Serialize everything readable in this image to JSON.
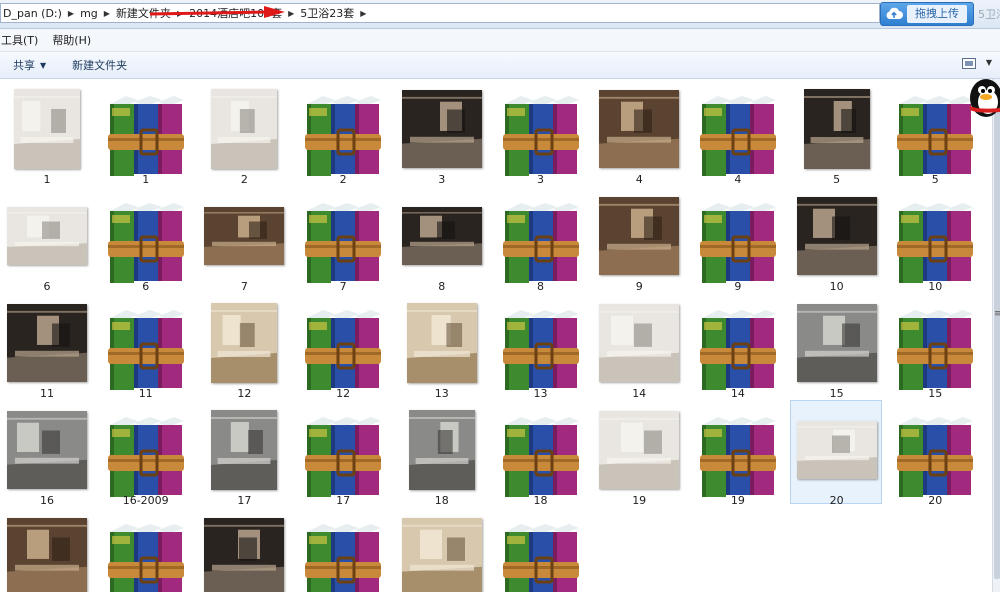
{
  "address": {
    "crumbs": [
      "D_pan (D:)",
      "mg",
      "新建文件夹",
      "2014酒店吧100套",
      "5卫浴23套"
    ],
    "faded_tab": "5卫浴"
  },
  "upload": {
    "label": "拖拽上传",
    "icon": "cloud-upload-icon"
  },
  "menu": [
    "工具(T)",
    "帮助(H)"
  ],
  "commands": {
    "share": "共享",
    "new_folder": "新建文件夹"
  },
  "colors": {
    "selection": "#e8f2fd",
    "upload_button": "#3d8edb",
    "rar_green": "#3d8b2e",
    "rar_blue": "#2a4fa8",
    "rar_magenta": "#a12a7e",
    "rar_belt": "#c8893a"
  },
  "files": [
    {
      "name": "1",
      "kind": "image",
      "style": "sq",
      "tone": "light"
    },
    {
      "name": "1",
      "kind": "rar"
    },
    {
      "name": "2",
      "kind": "image",
      "style": "sq",
      "tone": "light"
    },
    {
      "name": "2",
      "kind": "rar"
    },
    {
      "name": "3",
      "kind": "image",
      "style": "dark",
      "tone": "dark"
    },
    {
      "name": "3",
      "kind": "rar"
    },
    {
      "name": "4",
      "kind": "image",
      "style": "dark",
      "tone": "brown"
    },
    {
      "name": "4",
      "kind": "rar"
    },
    {
      "name": "5",
      "kind": "image",
      "style": "sq",
      "tone": "dark"
    },
    {
      "name": "5",
      "kind": "rar"
    },
    {
      "name": "6",
      "kind": "image",
      "style": "wd",
      "tone": "light"
    },
    {
      "name": "6",
      "kind": "rar"
    },
    {
      "name": "7",
      "kind": "image",
      "style": "wd",
      "tone": "brown"
    },
    {
      "name": "7",
      "kind": "rar"
    },
    {
      "name": "8",
      "kind": "image",
      "style": "wd",
      "tone": "dark"
    },
    {
      "name": "8",
      "kind": "rar"
    },
    {
      "name": "9",
      "kind": "image",
      "style": "dark",
      "tone": "brown"
    },
    {
      "name": "9",
      "kind": "rar"
    },
    {
      "name": "10",
      "kind": "image",
      "style": "dark",
      "tone": "dark"
    },
    {
      "name": "10",
      "kind": "rar"
    },
    {
      "name": "11",
      "kind": "image",
      "style": "dark",
      "tone": "dark"
    },
    {
      "name": "11",
      "kind": "rar"
    },
    {
      "name": "12",
      "kind": "image",
      "style": "sq",
      "tone": "beige"
    },
    {
      "name": "12",
      "kind": "rar"
    },
    {
      "name": "13",
      "kind": "image",
      "style": "tall",
      "tone": "beige"
    },
    {
      "name": "13",
      "kind": "rar"
    },
    {
      "name": "14",
      "kind": "image",
      "style": "dark",
      "tone": "light"
    },
    {
      "name": "14",
      "kind": "rar"
    },
    {
      "name": "15",
      "kind": "image",
      "style": "dark",
      "tone": "grey"
    },
    {
      "name": "15",
      "kind": "rar"
    },
    {
      "name": "16",
      "kind": "image",
      "style": "dark",
      "tone": "grey"
    },
    {
      "name": "16-2009",
      "kind": "rar"
    },
    {
      "name": "17",
      "kind": "image",
      "style": "sq",
      "tone": "grey"
    },
    {
      "name": "17",
      "kind": "rar"
    },
    {
      "name": "18",
      "kind": "image",
      "style": "sq",
      "tone": "grey"
    },
    {
      "name": "18",
      "kind": "rar"
    },
    {
      "name": "19",
      "kind": "image",
      "style": "dark",
      "tone": "light"
    },
    {
      "name": "19",
      "kind": "rar"
    },
    {
      "name": "20",
      "kind": "image",
      "style": "wd",
      "tone": "light",
      "selected": true
    },
    {
      "name": "20",
      "kind": "rar"
    },
    {
      "name": "",
      "kind": "image",
      "style": "dark",
      "tone": "brown"
    },
    {
      "name": "",
      "kind": "rar"
    },
    {
      "name": "",
      "kind": "image",
      "style": "dark",
      "tone": "dark"
    },
    {
      "name": "",
      "kind": "rar"
    },
    {
      "name": "",
      "kind": "image",
      "style": "dark",
      "tone": "beige"
    },
    {
      "name": "",
      "kind": "rar"
    }
  ]
}
